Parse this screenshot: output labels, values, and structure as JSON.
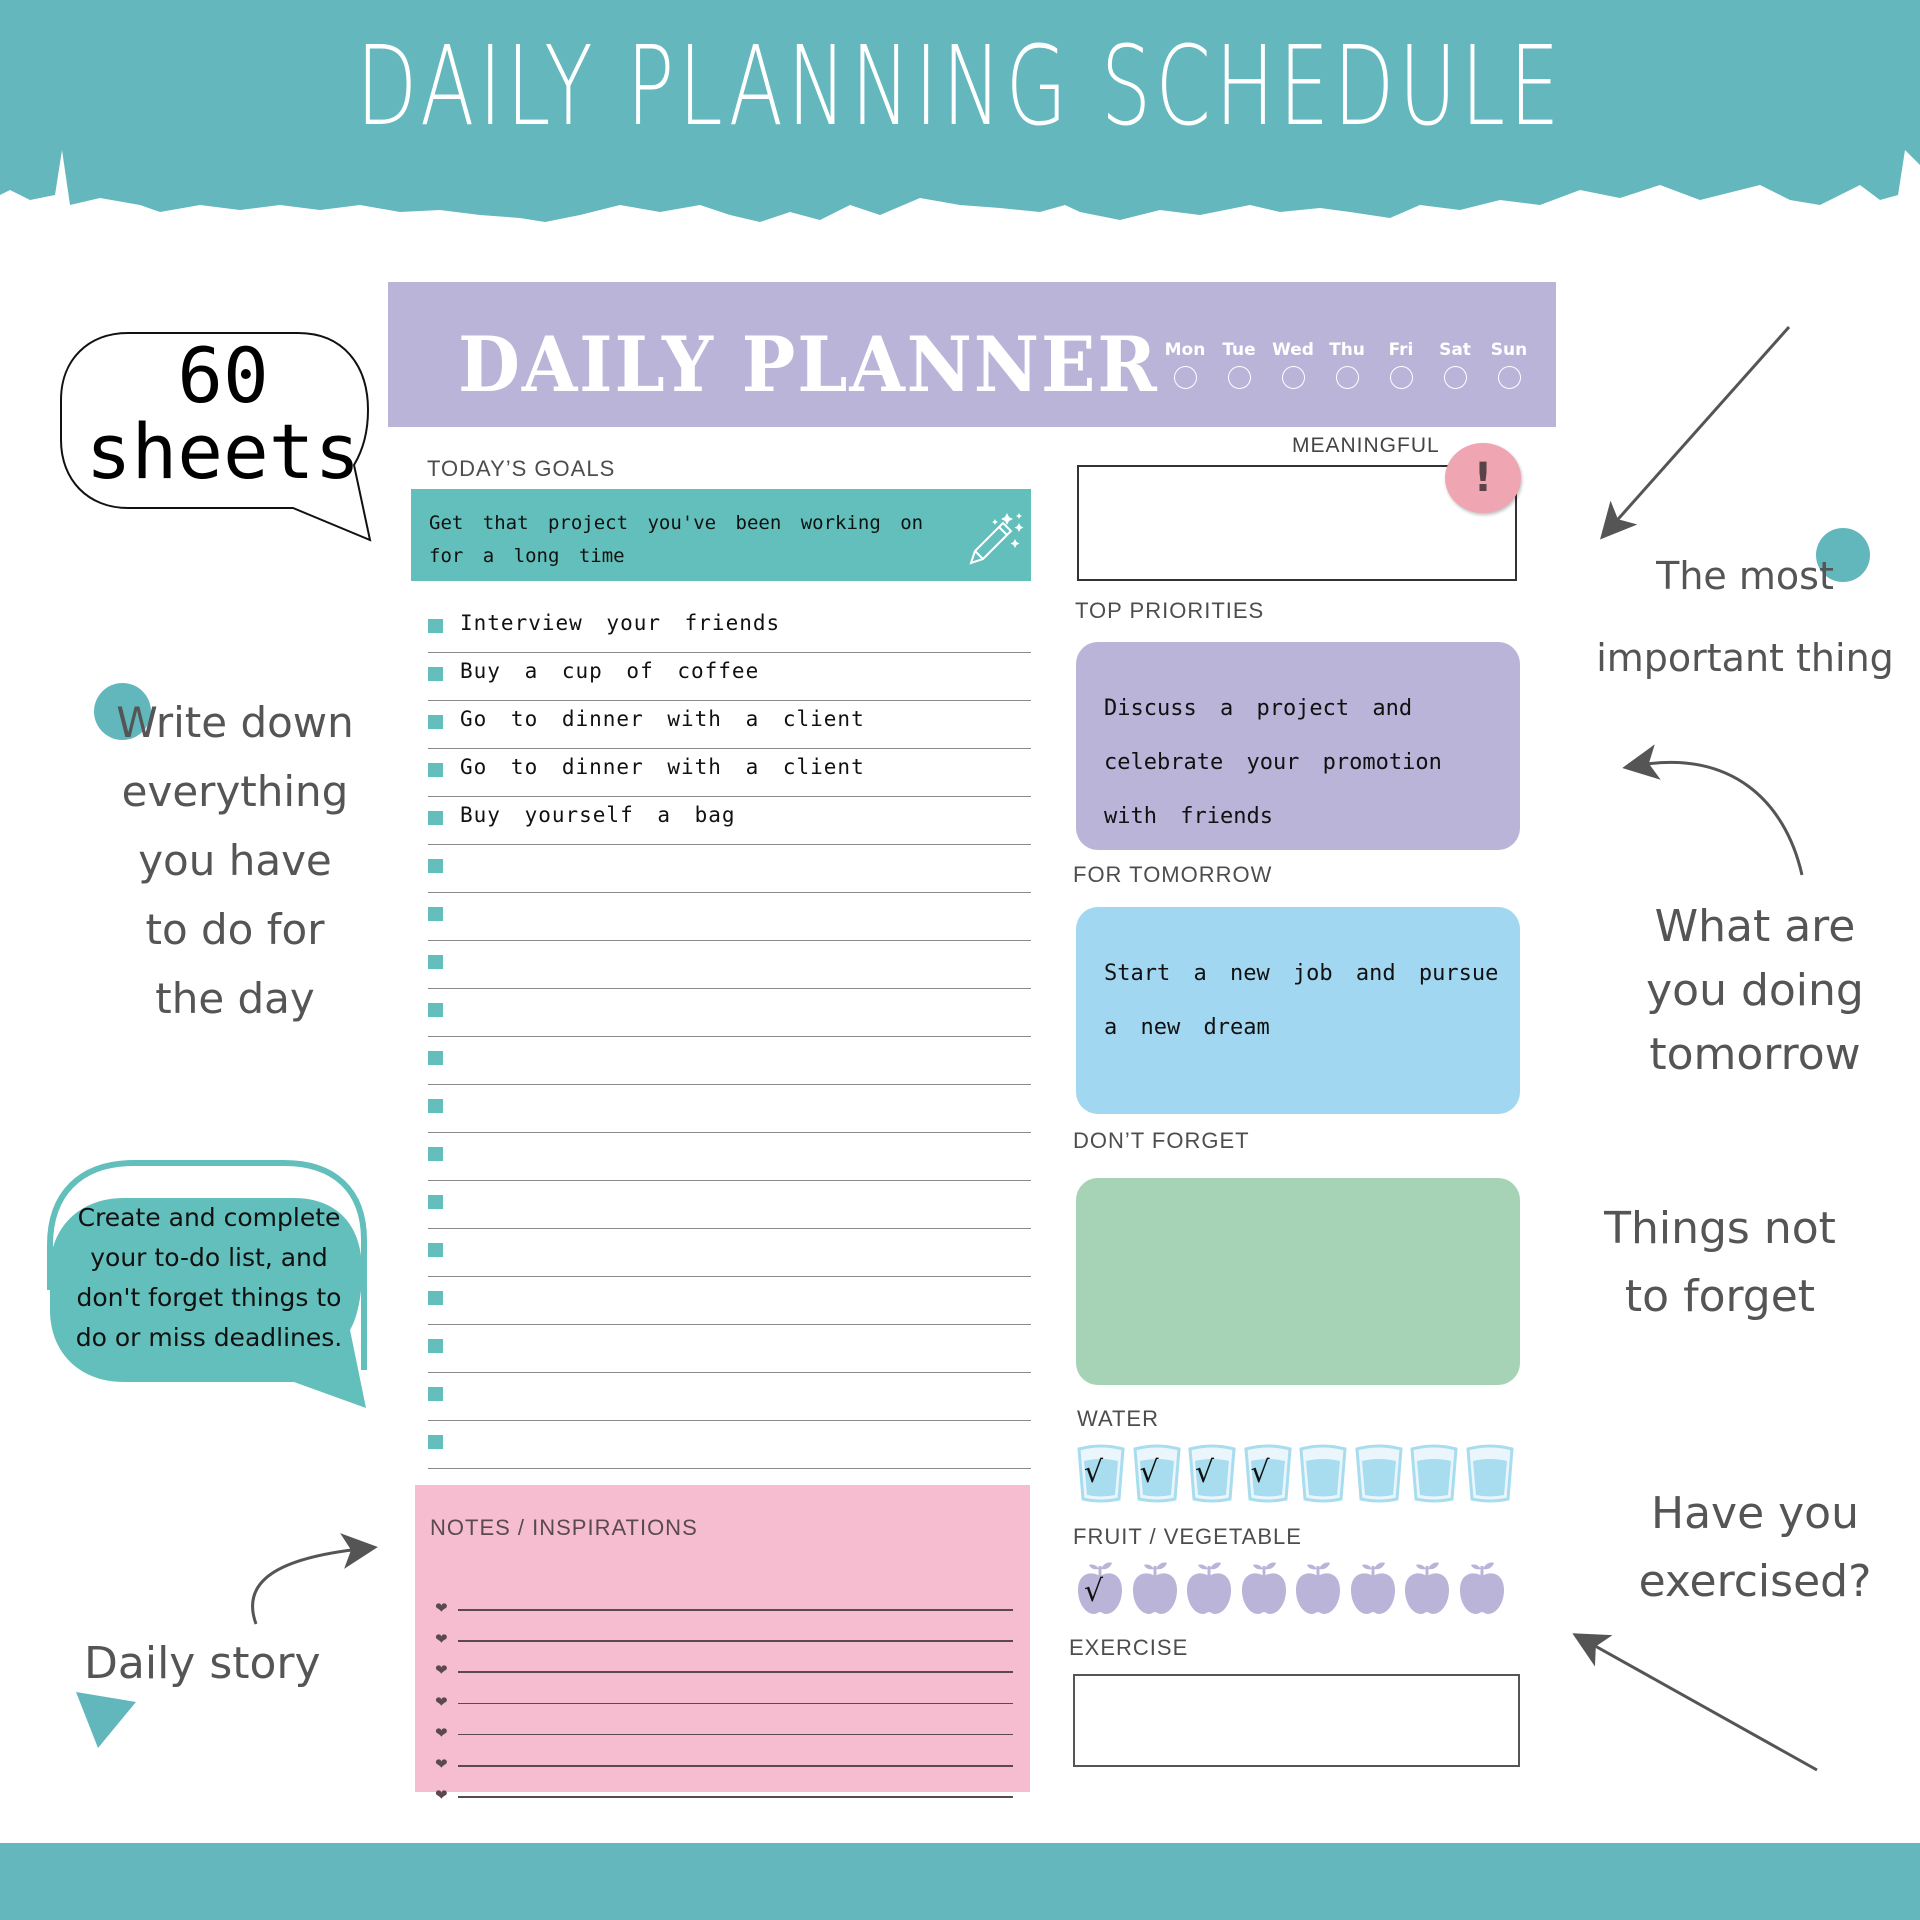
{
  "banner": {
    "title": "DAILY PLANNING SCHEDULE"
  },
  "colors": {
    "teal": "#63b7bd",
    "lavender": "#b9b4d8",
    "light_blue": "#a2d7f2",
    "mint": "#a6d3b5",
    "pink": "#f6bdd0",
    "badge_pink": "#f0a5b2"
  },
  "planner": {
    "title": "DAILY PLANNER",
    "days": [
      "Mon",
      "Tue",
      "Wed",
      "Thu",
      "Fri",
      "Sat",
      "Sun"
    ],
    "todays_goals": {
      "label": "TODAY’S GOALS",
      "main_goal": "Get that project you've been working on for a long time",
      "tasks": [
        "Interview your friends",
        "Buy a cup of coffee",
        "Go to dinner with a client",
        "Go to dinner with a client",
        "Buy yourself a bag",
        "",
        "",
        "",
        "",
        "",
        "",
        "",
        "",
        "",
        "",
        "",
        "",
        ""
      ]
    },
    "meaningful": {
      "label": "MEANINGFUL",
      "badge": "!"
    },
    "top_priorities": {
      "label": "TOP PRIORITIES",
      "text": "Discuss a project and celebrate your promotion with friends"
    },
    "for_tomorrow": {
      "label": "FOR TOMORROW",
      "text": "Start a new job and pursue a new dream"
    },
    "dont_forget": {
      "label": "DON’T FORGET",
      "text": ""
    },
    "water": {
      "label": "WATER",
      "total": 8,
      "checked": 4
    },
    "fruit_vegetable": {
      "label": "FRUIT / VEGETABLE",
      "total": 8,
      "checked": 1
    },
    "exercise": {
      "label": "EXERCISE",
      "text": ""
    },
    "notes": {
      "label": "NOTES / INSPIRATIONS",
      "lines": 7
    }
  },
  "annotations": {
    "sheets_line1": "60",
    "sheets_line2": "sheets",
    "write_down": [
      "Write down",
      "everything",
      "you have",
      "to do for",
      "the day"
    ],
    "todo_bubble": [
      "Create and complete",
      "your to-do list, and",
      "don't forget things to",
      "do or miss deadlines."
    ],
    "daily_story": "Daily story",
    "most_important": [
      "The most",
      "important thing"
    ],
    "tomorrow": [
      "What are",
      "you doing",
      "tomorrow"
    ],
    "not_forget": [
      "Things not",
      "to forget"
    ],
    "exercised": [
      "Have you",
      "exercised?"
    ]
  },
  "check_mark": "√",
  "heart_glyph": "❤"
}
